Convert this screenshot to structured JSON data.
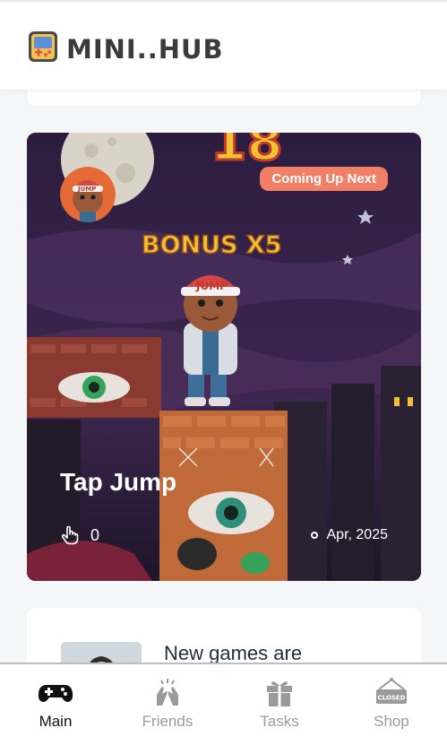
{
  "header": {
    "brand": "MINI..HUB",
    "logo_icon": "handheld-console-icon"
  },
  "featured_game": {
    "badge": "Coming Up Next",
    "title": "Tap Jump",
    "taps": "0",
    "date": "Apr, 2025",
    "art_bonus_text": "BONUS X5",
    "art_score": "18",
    "art_cap_text": "JUMP"
  },
  "news": {
    "title": "New games are"
  },
  "nav": {
    "items": [
      {
        "label": "Main",
        "icon": "gamepad-icon",
        "active": true
      },
      {
        "label": "Friends",
        "icon": "high-five-icon",
        "active": false
      },
      {
        "label": "Tasks",
        "icon": "gift-icon",
        "active": false
      },
      {
        "label": "Shop",
        "icon": "closed-sign-icon",
        "active": false
      }
    ],
    "shop_sign_text": "CLOSED"
  },
  "colors": {
    "badge": "#f07f66",
    "brand_text": "#3a3a3a",
    "card_bg": "#2b1d3c",
    "nav_active": "#111111",
    "nav_inactive": "#9a9a9a"
  }
}
